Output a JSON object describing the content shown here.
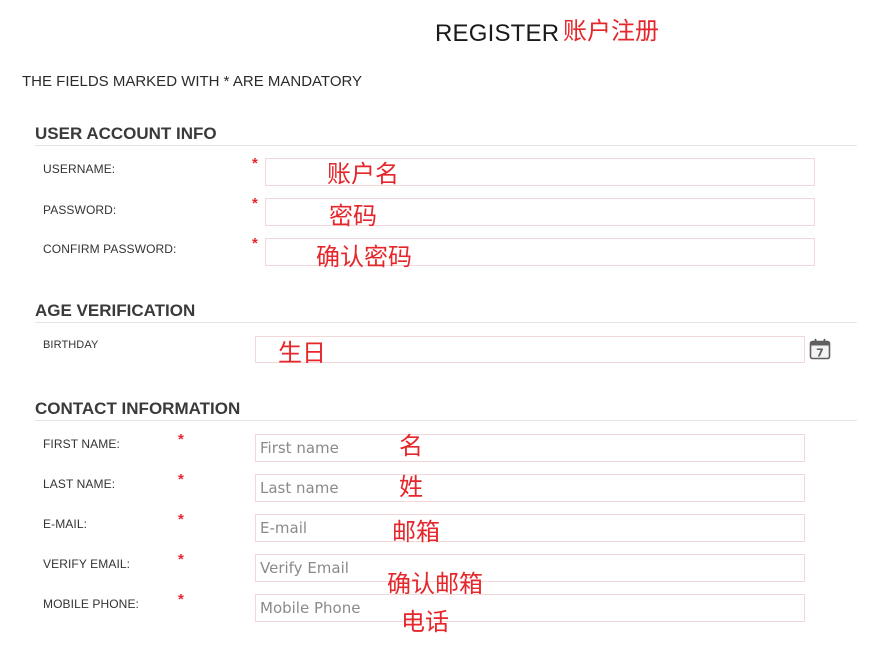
{
  "header": {
    "title": "REGISTER",
    "title_note": "账户注册"
  },
  "notice": "THE FIELDS MARKED WITH * ARE MANDATORY",
  "required_marker": "*",
  "sections": {
    "account": {
      "title": "USER ACCOUNT INFO",
      "username": {
        "label": "USERNAME:",
        "value": "",
        "note": "账户名"
      },
      "password": {
        "label": "PASSWORD:",
        "value": "",
        "note": "密码"
      },
      "confirm_password": {
        "label": "CONFIRM PASSWORD:",
        "value": "",
        "note": "确认密码"
      }
    },
    "age": {
      "title": "AGE VERIFICATION",
      "birthday": {
        "label": "BIRTHDAY",
        "value": "",
        "note": "生日",
        "calendar_day": "7"
      }
    },
    "contact": {
      "title": "CONTACT INFORMATION",
      "first_name": {
        "label": "FIRST NAME:",
        "placeholder": "First name",
        "value": "",
        "note": "名"
      },
      "last_name": {
        "label": "LAST NAME:",
        "placeholder": "Last name",
        "value": "",
        "note": "姓"
      },
      "email": {
        "label": "E-MAIL:",
        "placeholder": "E-mail",
        "value": "",
        "note": "邮箱"
      },
      "verify_email": {
        "label": "VERIFY EMAIL:",
        "placeholder": "Verify Email",
        "value": "",
        "note": "确认邮箱"
      },
      "mobile_phone": {
        "label": "MOBILE PHONE:",
        "placeholder": "Mobile Phone",
        "value": "",
        "note": "电话"
      }
    }
  },
  "icons": {
    "calendar": "calendar-icon"
  },
  "colors": {
    "required": "#e5262a",
    "annotation": "#e5262a",
    "input_border": "#f1d7d7",
    "divider": "#e5e5e5"
  }
}
